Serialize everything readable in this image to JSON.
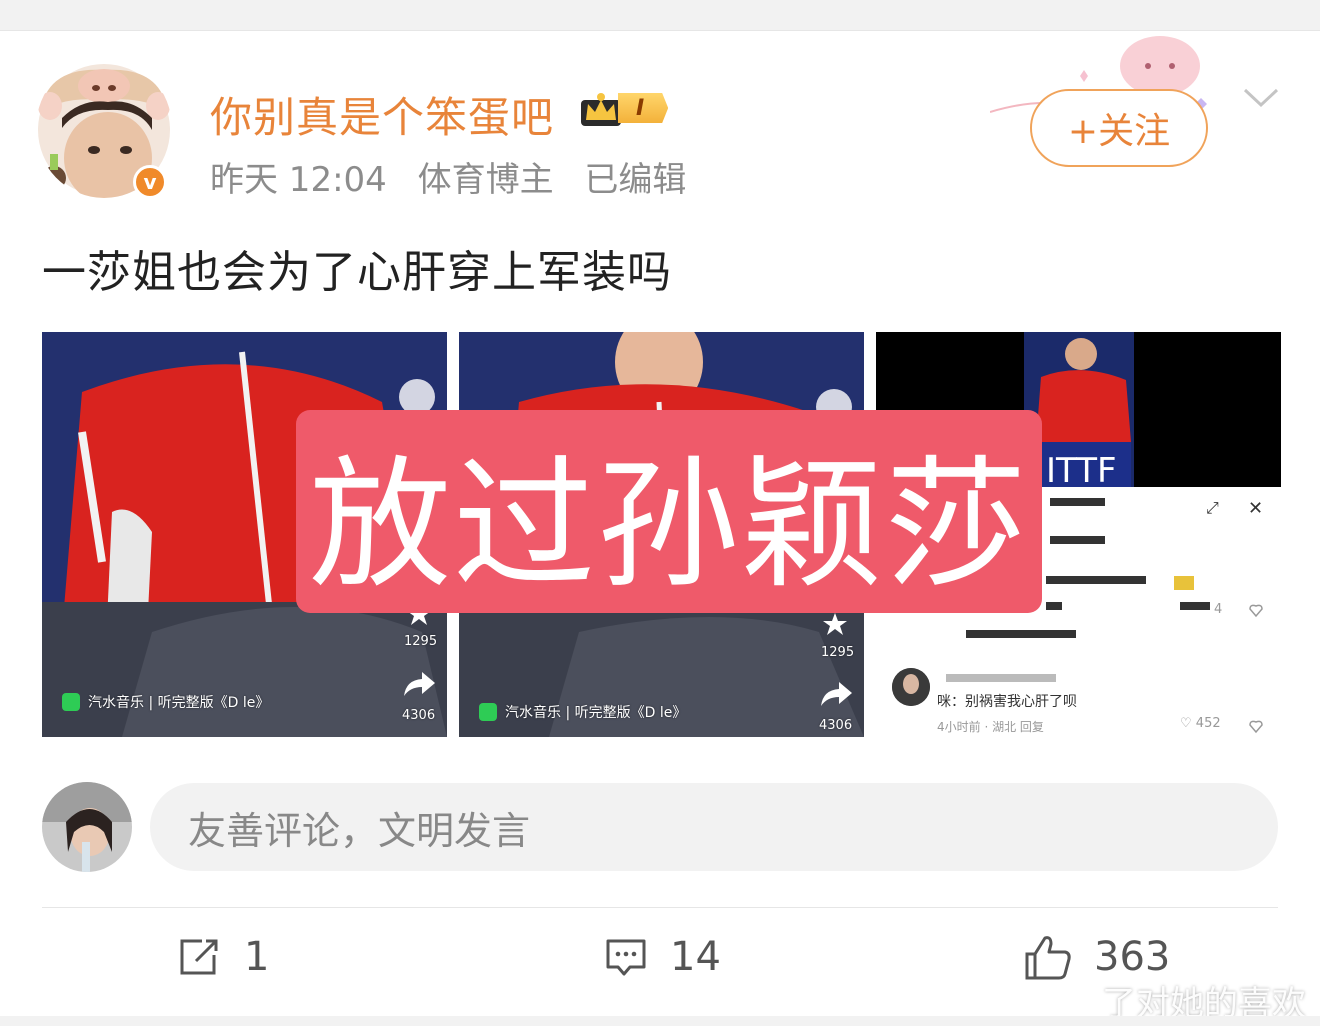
{
  "post": {
    "username": "你别真是个笨蛋吧",
    "rank": "I",
    "time": "昨天 12:04",
    "role": "体育博主",
    "edited": "已编辑",
    "follow_label": "+关注",
    "text": "一莎姐也会为了心肝穿上军装吗"
  },
  "media": {
    "overlay_text": "放过孙颖莎",
    "thumb1": {
      "likes": "1295",
      "shares": "4306",
      "music_label": "汽水音乐 | 听完整版《D le》"
    },
    "thumb2": {
      "likes": "1295",
      "shares": "4306",
      "music_label": "汽水音乐 | 听完整版《D le》"
    },
    "thumb3": {
      "banner_text": "ITTF",
      "comment_text": "咪：别祸害我心肝了呗",
      "comment_meta": "4小时前 · 湖北   回复",
      "comment_likes": "452",
      "small_count": "4"
    }
  },
  "comment_box": {
    "placeholder": "友善评论，文明发言"
  },
  "actions": {
    "repost_count": "1",
    "comment_count": "14",
    "like_count": "363"
  },
  "watermark": {
    "text": "了对她的喜欢"
  },
  "colors": {
    "brand_orange": "#e8843a",
    "overlay_red": "#ef5a6a",
    "vip_orange": "#f08a2a"
  }
}
